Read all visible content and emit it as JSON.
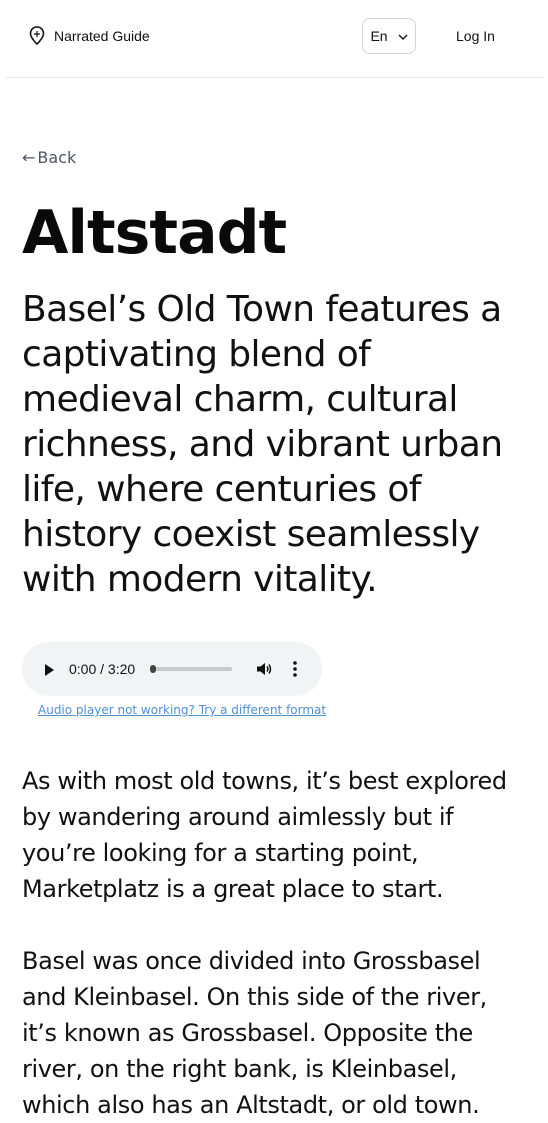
{
  "header": {
    "brand": "Narrated Guide",
    "brand_icon": "location-pin-icon",
    "language": "En",
    "login": "Log In"
  },
  "back": {
    "arrow": "←",
    "label": "Back"
  },
  "page": {
    "title": "Altstadt",
    "lead": "Basel’s Old Town features a captivating blend of medieval charm, cultural richness, and vibrant urban life, where centuries of history coexist seamlessly with modern vitality."
  },
  "audio": {
    "time": "0:00 / 3:20",
    "progress_fraction": 0.0,
    "fallback_link": "Audio player not working? Try a different format"
  },
  "paragraphs": [
    "As with most old towns, it’s best explored by wandering around aimlessly but if you’re looking for a starting point, Marketplatz is a great place to start.",
    "Basel was once divided into Grossbasel and Kleinbasel. On this side of the river, it’s known as Grossbasel. Opposite the river, on the right bank, is Kleinbasel, which also has an Altstadt, or old town."
  ],
  "colors": {
    "link": "#4f8fd6",
    "player_bg": "#f1f3f4",
    "muted_text": "#4b5563"
  }
}
